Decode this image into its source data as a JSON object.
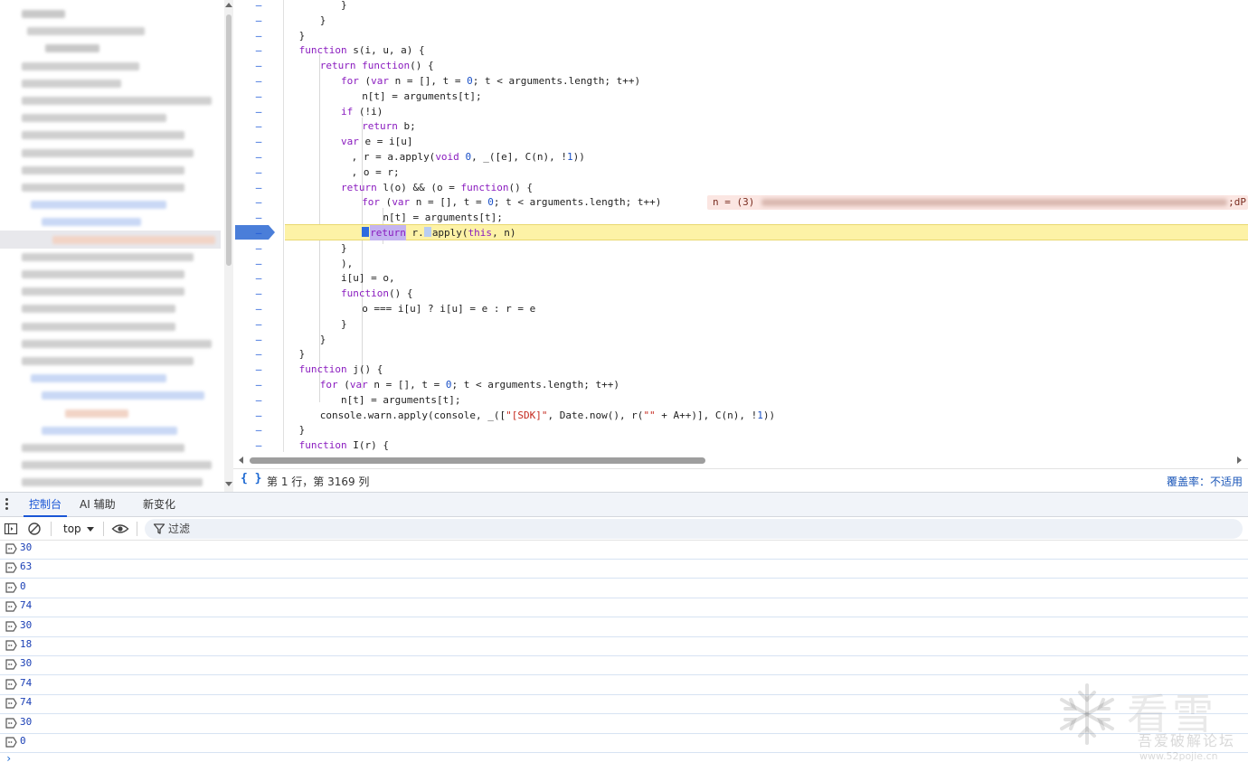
{
  "editor": {
    "gutter_marker": "–",
    "inline_value": {
      "label": "n = (3)",
      "tail": ";dP"
    },
    "lines": [
      [
        {
          "t": "}",
          "c": ""
        }
      ],
      [
        {
          "t": "}",
          "c": ""
        }
      ],
      [
        {
          "t": "}",
          "c": ""
        }
      ],
      [
        {
          "t": "function",
          "c": "kw"
        },
        {
          "t": " s(i, u, a) {",
          "c": ""
        }
      ],
      [
        {
          "t": "return",
          "c": "kw"
        },
        {
          "t": " ",
          "c": ""
        },
        {
          "t": "function",
          "c": "kw"
        },
        {
          "t": "() {",
          "c": ""
        }
      ],
      [
        {
          "t": "for",
          "c": "kw"
        },
        {
          "t": " (",
          "c": ""
        },
        {
          "t": "var",
          "c": "kw"
        },
        {
          "t": " n = [], t = ",
          "c": ""
        },
        {
          "t": "0",
          "c": "num"
        },
        {
          "t": "; t < arguments.length; t++)",
          "c": ""
        }
      ],
      [
        {
          "t": "n[t] = arguments[t];",
          "c": ""
        }
      ],
      [
        {
          "t": "if",
          "c": "kw"
        },
        {
          "t": " (!i)",
          "c": ""
        }
      ],
      [
        {
          "t": "return",
          "c": "kw"
        },
        {
          "t": " b;",
          "c": ""
        }
      ],
      [
        {
          "t": "var",
          "c": "kw"
        },
        {
          "t": " e = i[u]",
          "c": ""
        }
      ],
      [
        {
          "t": ", r = a.apply(",
          "c": ""
        },
        {
          "t": "void",
          "c": "kw"
        },
        {
          "t": " ",
          "c": ""
        },
        {
          "t": "0",
          "c": "num"
        },
        {
          "t": ", _([e], C(n), !",
          "c": ""
        },
        {
          "t": "1",
          "c": "num"
        },
        {
          "t": "))",
          "c": ""
        }
      ],
      [
        {
          "t": ", o = r;",
          "c": ""
        }
      ],
      [
        {
          "t": "return",
          "c": "kw"
        },
        {
          "t": " l(o) && (o = ",
          "c": ""
        },
        {
          "t": "function",
          "c": "kw"
        },
        {
          "t": "() {",
          "c": ""
        }
      ],
      [
        {
          "t": "for",
          "c": "kw"
        },
        {
          "t": " (",
          "c": ""
        },
        {
          "t": "var",
          "c": "kw"
        },
        {
          "t": " n = [], t = ",
          "c": ""
        },
        {
          "t": "0",
          "c": "num"
        },
        {
          "t": "; t < arguments.length; t++)",
          "c": ""
        }
      ],
      [
        {
          "t": "n[t] = arguments[t];",
          "c": ""
        }
      ],
      [
        {
          "t": "return",
          "c": "kw"
        },
        {
          "t": " r.",
          "c": ""
        },
        {
          "t": "apply(",
          "c": ""
        },
        {
          "t": "this",
          "c": "kw"
        },
        {
          "t": ", n)",
          "c": ""
        }
      ],
      [
        {
          "t": "}",
          "c": ""
        }
      ],
      [
        {
          "t": "),",
          "c": ""
        }
      ],
      [
        {
          "t": "i[u] = o,",
          "c": ""
        }
      ],
      [
        {
          "t": "function",
          "c": "kw"
        },
        {
          "t": "() {",
          "c": ""
        }
      ],
      [
        {
          "t": "o === i[u] ? i[u] = e : r = e",
          "c": ""
        }
      ],
      [
        {
          "t": "}",
          "c": ""
        }
      ],
      [
        {
          "t": "}",
          "c": ""
        }
      ],
      [
        {
          "t": "}",
          "c": ""
        }
      ],
      [
        {
          "t": "function",
          "c": "kw"
        },
        {
          "t": " j() {",
          "c": ""
        }
      ],
      [
        {
          "t": "for",
          "c": "kw"
        },
        {
          "t": " (",
          "c": ""
        },
        {
          "t": "var",
          "c": "kw"
        },
        {
          "t": " n = [], t = ",
          "c": ""
        },
        {
          "t": "0",
          "c": "num"
        },
        {
          "t": "; t < arguments.length; t++)",
          "c": ""
        }
      ],
      [
        {
          "t": "n[t] = arguments[t];",
          "c": ""
        }
      ],
      [
        {
          "t": "console.warn.apply(console, _([",
          "c": ""
        },
        {
          "t": "\"[SDK]\"",
          "c": "str"
        },
        {
          "t": ", Date.now(), r(",
          "c": ""
        },
        {
          "t": "\"\"",
          "c": "str"
        },
        {
          "t": " + A++)], C(n), !",
          "c": ""
        },
        {
          "t": "1",
          "c": "num"
        },
        {
          "t": "))",
          "c": ""
        }
      ],
      [
        {
          "t": "}",
          "c": ""
        }
      ],
      [
        {
          "t": "function",
          "c": "kw"
        },
        {
          "t": " I(r) {",
          "c": ""
        }
      ]
    ]
  },
  "status": {
    "pretty_print": "{ }",
    "position": "第 1 行，第 3169 列",
    "coverage": "覆盖率：不适用"
  },
  "drawer": {
    "tabs": [
      {
        "label": "控制台",
        "active": true
      },
      {
        "label": "AI 辅助",
        "active": false
      },
      {
        "label": "新变化",
        "active": false
      }
    ]
  },
  "console": {
    "context": "top",
    "filter_placeholder": "过滤",
    "messages": [
      "30",
      "63",
      "0",
      "74",
      "30",
      "18",
      "30",
      "74",
      "74",
      "30",
      "0"
    ],
    "prompt": "›"
  },
  "watermark": {
    "title": "看雪",
    "subtitle": "吾爱破解论坛",
    "url": "www.52pojie.cn"
  },
  "colors": {
    "accent": "#1a56d6",
    "paused_line": "#fdf2a6",
    "keyword": "#8a1cbf",
    "number": "#1a50c7"
  }
}
